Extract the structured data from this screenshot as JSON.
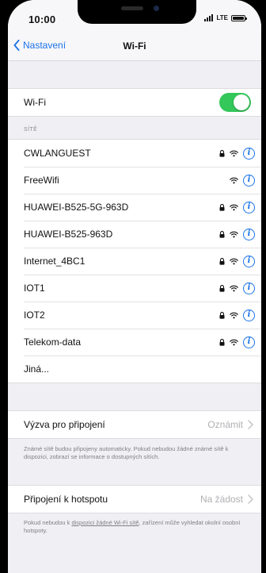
{
  "status_bar": {
    "time": "10:00",
    "network": "LTE"
  },
  "nav": {
    "back_label": "Nastavení",
    "title": "Wi-Fi"
  },
  "wifi_toggle": {
    "label": "Wi-Fi",
    "on": true
  },
  "networks_header": "SÍTĚ",
  "networks": [
    {
      "name": "CWLANGUEST",
      "locked": true
    },
    {
      "name": "FreeWifi",
      "locked": false
    },
    {
      "name": "HUAWEI-B525-5G-963D",
      "locked": true
    },
    {
      "name": "HUAWEI-B525-963D",
      "locked": true
    },
    {
      "name": "Internet_4BC1",
      "locked": true
    },
    {
      "name": "IOT1",
      "locked": true
    },
    {
      "name": "IOT2",
      "locked": true
    },
    {
      "name": "Telekom-data",
      "locked": true
    }
  ],
  "other_label": "Jiná...",
  "ask_to_join": {
    "label": "Výzva pro připojení",
    "value": "Oznámit",
    "footnote": "Známé sítě budou připojeny automaticky. Pokud nebudou žádné známé sítě k dispozici, zobrazí se informace o dostupných sítích."
  },
  "hotspot": {
    "label": "Připojení k hotspotu",
    "value": "Na žádost",
    "footnote_prefix": "Pokud nebudou k ",
    "footnote_link": "dispozici žádné Wi-Fi sítě",
    "footnote_suffix": ", zařízení může vyhledat okolní osobní hotspoty."
  },
  "colors": {
    "accent": "#1a73e8",
    "toggle_on": "#34c759"
  }
}
